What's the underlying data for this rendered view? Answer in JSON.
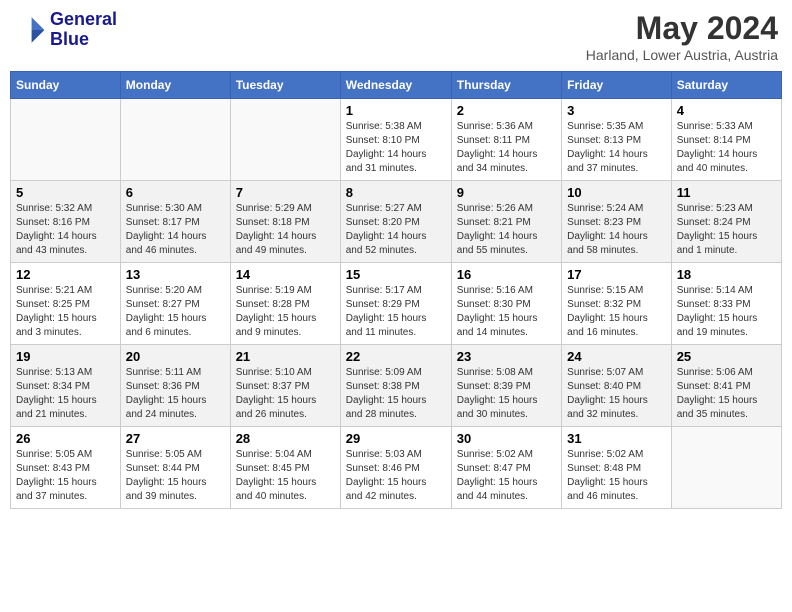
{
  "header": {
    "logo_line1": "General",
    "logo_line2": "Blue",
    "title": "May 2024",
    "subtitle": "Harland, Lower Austria, Austria"
  },
  "columns": [
    "Sunday",
    "Monday",
    "Tuesday",
    "Wednesday",
    "Thursday",
    "Friday",
    "Saturday"
  ],
  "weeks": [
    [
      {
        "day": "",
        "info": ""
      },
      {
        "day": "",
        "info": ""
      },
      {
        "day": "",
        "info": ""
      },
      {
        "day": "1",
        "info": "Sunrise: 5:38 AM\nSunset: 8:10 PM\nDaylight: 14 hours\nand 31 minutes."
      },
      {
        "day": "2",
        "info": "Sunrise: 5:36 AM\nSunset: 8:11 PM\nDaylight: 14 hours\nand 34 minutes."
      },
      {
        "day": "3",
        "info": "Sunrise: 5:35 AM\nSunset: 8:13 PM\nDaylight: 14 hours\nand 37 minutes."
      },
      {
        "day": "4",
        "info": "Sunrise: 5:33 AM\nSunset: 8:14 PM\nDaylight: 14 hours\nand 40 minutes."
      }
    ],
    [
      {
        "day": "5",
        "info": "Sunrise: 5:32 AM\nSunset: 8:16 PM\nDaylight: 14 hours\nand 43 minutes."
      },
      {
        "day": "6",
        "info": "Sunrise: 5:30 AM\nSunset: 8:17 PM\nDaylight: 14 hours\nand 46 minutes."
      },
      {
        "day": "7",
        "info": "Sunrise: 5:29 AM\nSunset: 8:18 PM\nDaylight: 14 hours\nand 49 minutes."
      },
      {
        "day": "8",
        "info": "Sunrise: 5:27 AM\nSunset: 8:20 PM\nDaylight: 14 hours\nand 52 minutes."
      },
      {
        "day": "9",
        "info": "Sunrise: 5:26 AM\nSunset: 8:21 PM\nDaylight: 14 hours\nand 55 minutes."
      },
      {
        "day": "10",
        "info": "Sunrise: 5:24 AM\nSunset: 8:23 PM\nDaylight: 14 hours\nand 58 minutes."
      },
      {
        "day": "11",
        "info": "Sunrise: 5:23 AM\nSunset: 8:24 PM\nDaylight: 15 hours\nand 1 minute."
      }
    ],
    [
      {
        "day": "12",
        "info": "Sunrise: 5:21 AM\nSunset: 8:25 PM\nDaylight: 15 hours\nand 3 minutes."
      },
      {
        "day": "13",
        "info": "Sunrise: 5:20 AM\nSunset: 8:27 PM\nDaylight: 15 hours\nand 6 minutes."
      },
      {
        "day": "14",
        "info": "Sunrise: 5:19 AM\nSunset: 8:28 PM\nDaylight: 15 hours\nand 9 minutes."
      },
      {
        "day": "15",
        "info": "Sunrise: 5:17 AM\nSunset: 8:29 PM\nDaylight: 15 hours\nand 11 minutes."
      },
      {
        "day": "16",
        "info": "Sunrise: 5:16 AM\nSunset: 8:30 PM\nDaylight: 15 hours\nand 14 minutes."
      },
      {
        "day": "17",
        "info": "Sunrise: 5:15 AM\nSunset: 8:32 PM\nDaylight: 15 hours\nand 16 minutes."
      },
      {
        "day": "18",
        "info": "Sunrise: 5:14 AM\nSunset: 8:33 PM\nDaylight: 15 hours\nand 19 minutes."
      }
    ],
    [
      {
        "day": "19",
        "info": "Sunrise: 5:13 AM\nSunset: 8:34 PM\nDaylight: 15 hours\nand 21 minutes."
      },
      {
        "day": "20",
        "info": "Sunrise: 5:11 AM\nSunset: 8:36 PM\nDaylight: 15 hours\nand 24 minutes."
      },
      {
        "day": "21",
        "info": "Sunrise: 5:10 AM\nSunset: 8:37 PM\nDaylight: 15 hours\nand 26 minutes."
      },
      {
        "day": "22",
        "info": "Sunrise: 5:09 AM\nSunset: 8:38 PM\nDaylight: 15 hours\nand 28 minutes."
      },
      {
        "day": "23",
        "info": "Sunrise: 5:08 AM\nSunset: 8:39 PM\nDaylight: 15 hours\nand 30 minutes."
      },
      {
        "day": "24",
        "info": "Sunrise: 5:07 AM\nSunset: 8:40 PM\nDaylight: 15 hours\nand 32 minutes."
      },
      {
        "day": "25",
        "info": "Sunrise: 5:06 AM\nSunset: 8:41 PM\nDaylight: 15 hours\nand 35 minutes."
      }
    ],
    [
      {
        "day": "26",
        "info": "Sunrise: 5:05 AM\nSunset: 8:43 PM\nDaylight: 15 hours\nand 37 minutes."
      },
      {
        "day": "27",
        "info": "Sunrise: 5:05 AM\nSunset: 8:44 PM\nDaylight: 15 hours\nand 39 minutes."
      },
      {
        "day": "28",
        "info": "Sunrise: 5:04 AM\nSunset: 8:45 PM\nDaylight: 15 hours\nand 40 minutes."
      },
      {
        "day": "29",
        "info": "Sunrise: 5:03 AM\nSunset: 8:46 PM\nDaylight: 15 hours\nand 42 minutes."
      },
      {
        "day": "30",
        "info": "Sunrise: 5:02 AM\nSunset: 8:47 PM\nDaylight: 15 hours\nand 44 minutes."
      },
      {
        "day": "31",
        "info": "Sunrise: 5:02 AM\nSunset: 8:48 PM\nDaylight: 15 hours\nand 46 minutes."
      },
      {
        "day": "",
        "info": ""
      }
    ]
  ]
}
